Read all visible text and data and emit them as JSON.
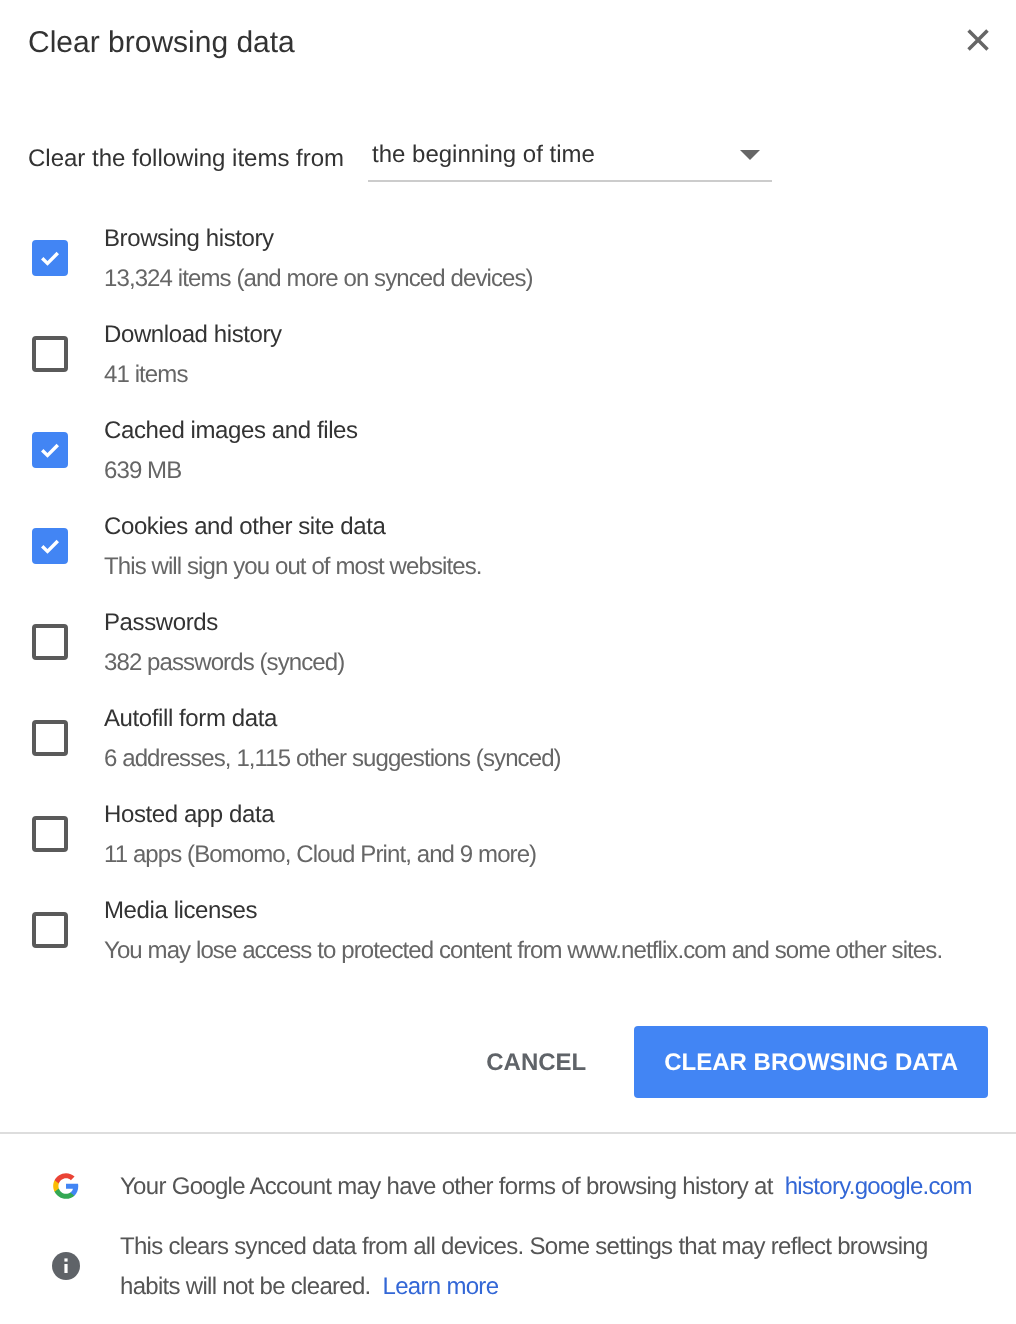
{
  "dialog": {
    "title": "Clear browsing data",
    "close": "×"
  },
  "time_range": {
    "label": "Clear the following items from",
    "value": "the beginning of time"
  },
  "items": [
    {
      "label": "Browsing history",
      "detail": "13,324 items (and more on synced devices)",
      "checked": true
    },
    {
      "label": "Download history",
      "detail": "41 items",
      "checked": false
    },
    {
      "label": "Cached images and files",
      "detail": "639 MB",
      "checked": true
    },
    {
      "label": "Cookies and other site data",
      "detail": "This will sign you out of most websites.",
      "checked": true
    },
    {
      "label": "Passwords",
      "detail": "382 passwords (synced)",
      "checked": false
    },
    {
      "label": "Autofill form data",
      "detail": "6 addresses, 1,115 other suggestions (synced)",
      "checked": false
    },
    {
      "label": "Hosted app data",
      "detail": "11 apps (Bomomo, Cloud Print, and 9 more)",
      "checked": false
    },
    {
      "label": "Media licenses",
      "detail": "You may lose access to protected content from www.netflix.com and some other sites.",
      "checked": false
    }
  ],
  "buttons": [
    {
      "label": "CANCEL",
      "kind": "text"
    },
    {
      "label": "CLEAR BROWSING DATA",
      "kind": "primary"
    }
  ],
  "notes": [
    {
      "kind": "google",
      "text": "Your Google Account may have other forms of browsing history at",
      "link": "history.google.com"
    },
    {
      "kind": "info",
      "text": "This clears synced data from all devices. Some settings that may reflect browsing habits will not be cleared.",
      "link": "Learn more"
    }
  ]
}
